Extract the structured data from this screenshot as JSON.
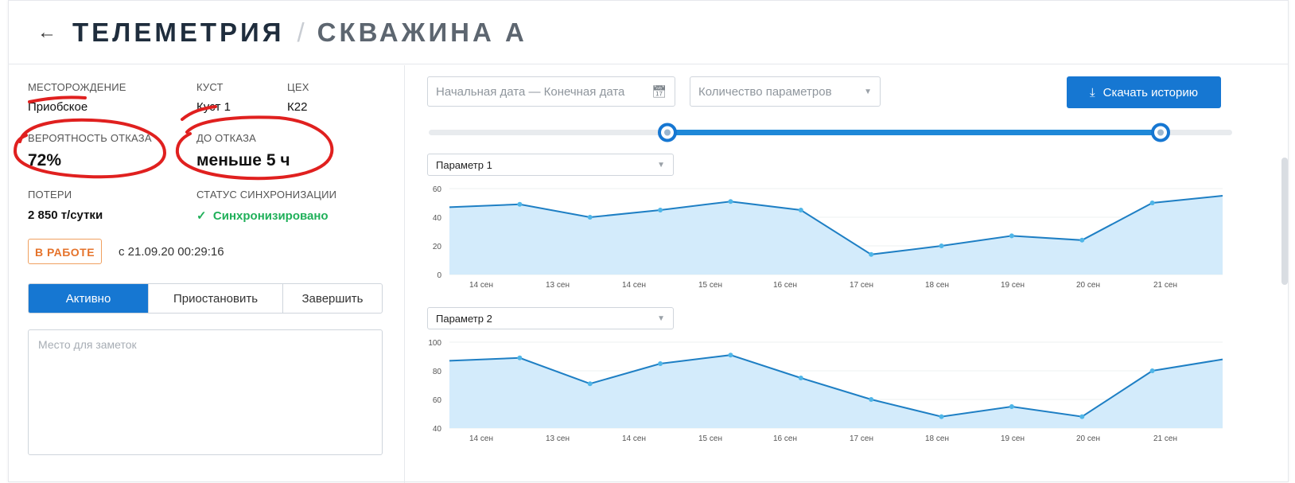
{
  "header": {
    "back_icon": "arrow-left-icon",
    "title": "ТЕЛЕМЕТРИЯ",
    "separator": "/",
    "subtitle": "СКВАЖИНА А"
  },
  "info": {
    "field_label": "МЕСТОРОЖДЕНИЕ",
    "field_value": "Приобское",
    "pad_label": "КУСТ",
    "pad_value": "Куст 1",
    "shop_label": "ЦЕХ",
    "shop_value": "К22",
    "prob_label": "ВЕРОЯТНОСТЬ ОТКАЗА",
    "prob_value": "72%",
    "until_label": "ДО ОТКАЗА",
    "until_value": "меньше 5 ч",
    "loss_label": "ПОТЕРИ",
    "loss_value": "2 850 т/сутки",
    "sync_label": "СТАТУС СИНХРОНИЗАЦИИ",
    "sync_value": "Синхронизировано"
  },
  "status": {
    "badge": "В РАБОТЕ",
    "since": "с 21.09.20 00:29:16"
  },
  "segmented": {
    "active": "Активно",
    "pause": "Приостановить",
    "finish": "Завершить"
  },
  "notes": {
    "placeholder": "Место для заметок"
  },
  "toolbar": {
    "date_placeholder": "Начальная дата — Конечная дата",
    "params_placeholder": "Количество параметров",
    "download_label": "Скачать историю"
  },
  "colors": {
    "accent": "#1677d2",
    "line": "#1e7fc4",
    "area": "#d3ebfb",
    "annotation": "#e0201f",
    "sync": "#20b05a",
    "badge": "#e5732b"
  },
  "chart_data": [
    {
      "type": "area",
      "title": "Параметр 1",
      "categories": [
        "14 сен",
        "13 сен",
        "14 сен",
        "15 сен",
        "16 сен",
        "17 сен",
        "18 сен",
        "19 сен",
        "20 сен",
        "21 сен"
      ],
      "values": [
        47,
        49,
        40,
        45,
        51,
        45,
        14,
        20,
        27,
        24,
        50,
        55
      ],
      "ylim": [
        0,
        60
      ],
      "yticks": [
        0,
        20,
        40,
        60
      ],
      "grid": true
    },
    {
      "type": "area",
      "title": "Параметр 2",
      "categories": [
        "14 сен",
        "13 сен",
        "14 сен",
        "15 сен",
        "16 сен",
        "17 сен",
        "18 сен",
        "19 сен",
        "20 сен",
        "21 сен"
      ],
      "values": [
        87,
        89,
        71,
        85,
        91,
        75,
        60,
        48,
        55,
        48,
        80,
        88
      ],
      "ylim": [
        40,
        100
      ],
      "yticks": [
        40,
        60,
        80,
        100
      ],
      "grid": true
    }
  ]
}
